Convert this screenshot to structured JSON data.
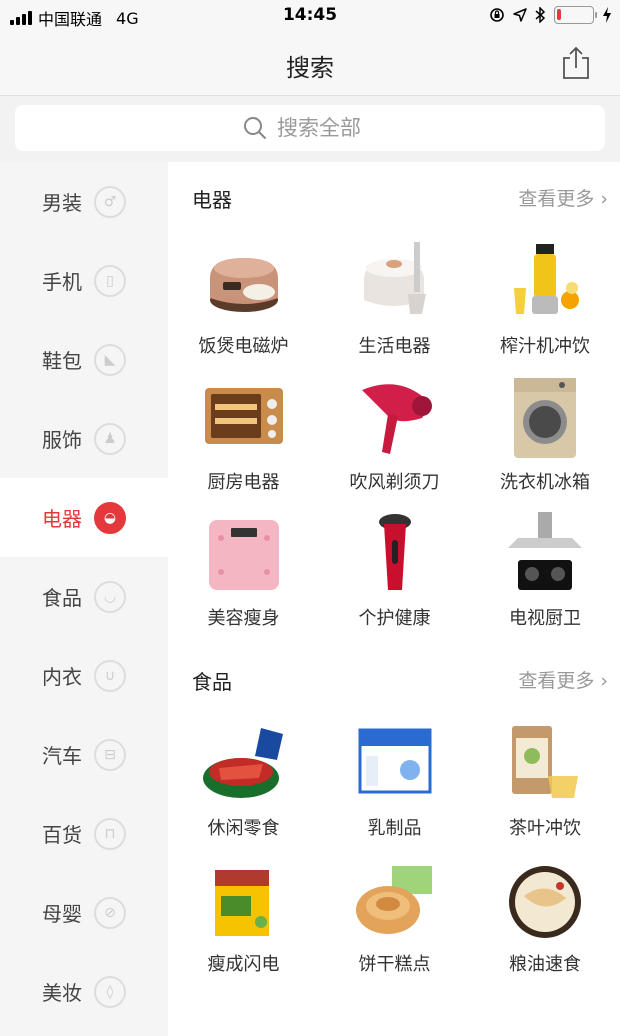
{
  "status_bar": {
    "carrier": "中国联通",
    "network": "4G",
    "time": "14:45",
    "battery_level": 0.12,
    "battery_color": "#e23b3b"
  },
  "nav": {
    "title": "搜索",
    "share_icon": "share-icon"
  },
  "search": {
    "placeholder": "搜索全部",
    "icon": "search-icon"
  },
  "accent_color": "#e4393c",
  "sidebar": {
    "items": [
      {
        "label": "男装",
        "icon": "tie-icon",
        "glyph": "♂"
      },
      {
        "label": "手机",
        "icon": "phone-icon",
        "glyph": "▯"
      },
      {
        "label": "鞋包",
        "icon": "shoe-icon",
        "glyph": "◣"
      },
      {
        "label": "服饰",
        "icon": "shirt-icon",
        "glyph": "♟"
      },
      {
        "label": "电器",
        "icon": "rice-cooker-icon",
        "glyph": "◒",
        "active": true
      },
      {
        "label": "食品",
        "icon": "cup-icon",
        "glyph": "◡"
      },
      {
        "label": "内衣",
        "icon": "underwear-icon",
        "glyph": "∪"
      },
      {
        "label": "汽车",
        "icon": "car-icon",
        "glyph": "⊟"
      },
      {
        "label": "百货",
        "icon": "bag-icon",
        "glyph": "⊓"
      },
      {
        "label": "母婴",
        "icon": "bottle-icon",
        "glyph": "⊘"
      },
      {
        "label": "美妆",
        "icon": "lipstick-icon",
        "glyph": "◊"
      }
    ]
  },
  "sections": [
    {
      "title": "电器",
      "more": "查看更多 ›",
      "items": [
        {
          "label": "饭煲电磁炉",
          "icon": "rice-cooker-image"
        },
        {
          "label": "生活电器",
          "icon": "appliance-image"
        },
        {
          "label": "榨汁机冲饮",
          "icon": "juicer-image"
        },
        {
          "label": "厨房电器",
          "icon": "oven-image"
        },
        {
          "label": "吹风剃须刀",
          "icon": "hair-dryer-image"
        },
        {
          "label": "洗衣机冰箱",
          "icon": "washing-machine-image"
        },
        {
          "label": "美容瘦身",
          "icon": "scale-image"
        },
        {
          "label": "个护健康",
          "icon": "shaver-image"
        },
        {
          "label": "电视厨卫",
          "icon": "range-hood-image"
        }
      ]
    },
    {
      "title": "食品",
      "more": "查看更多 ›",
      "items": [
        {
          "label": "休闲零食",
          "icon": "snack-image"
        },
        {
          "label": "乳制品",
          "icon": "milk-box-image"
        },
        {
          "label": "茶叶冲饮",
          "icon": "tea-image"
        },
        {
          "label": "瘦成闪电",
          "icon": "diet-tea-image"
        },
        {
          "label": "饼干糕点",
          "icon": "bread-image"
        },
        {
          "label": "粮油速食",
          "icon": "noodle-image"
        }
      ]
    }
  ]
}
